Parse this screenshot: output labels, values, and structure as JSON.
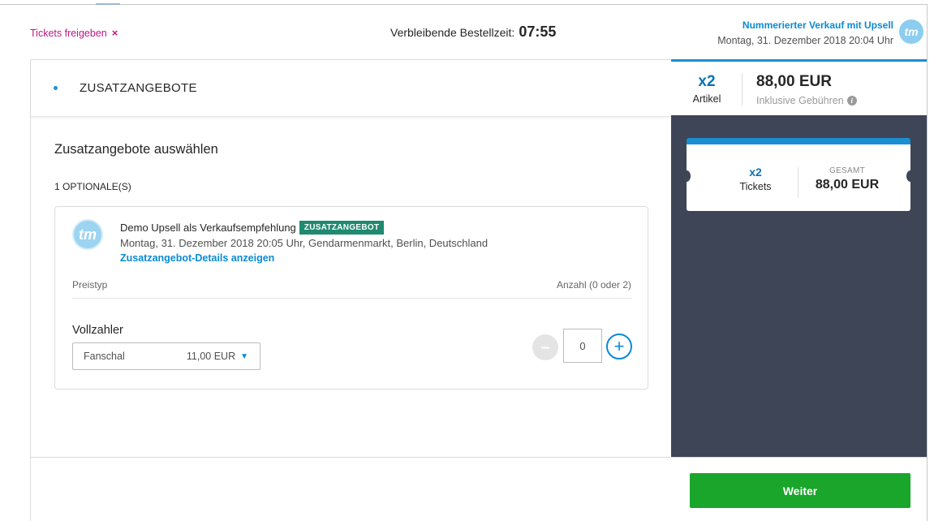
{
  "header": {
    "release_label": "Tickets freigeben",
    "release_icon": "×",
    "timer_label": "Verbleibende Bestellzeit:",
    "timer_value": "07:55",
    "event_name": "Nummerierter Verkauf mit Upsell",
    "event_date": "Montag, 31. Dezember 2018 20:04 Uhr",
    "avatar_text": "tm"
  },
  "section": {
    "title": "ZUSATZANGEBOTE"
  },
  "main": {
    "choose_title": "Zusatzangebote auswählen",
    "optional_count": "1 OPTIONALE(S)",
    "offer": {
      "avatar_text": "tm",
      "name": "Demo Upsell als Verkaufsempfehlung",
      "badge": "ZUSATZANGEBOT",
      "date_location": "Montag, 31. Dezember 2018 20:05 Uhr, Gendarmenmarkt, Berlin, Deutschland",
      "details_link": "Zusatzangebot-Details anzeigen",
      "col_price_type": "Preistyp",
      "col_quantity": "Anzahl (0 oder 2)",
      "price_type": "Vollzahler",
      "select_name": "Fanschal",
      "select_price": "11,00 EUR",
      "quantity": "0"
    }
  },
  "summary": {
    "qty": "x2",
    "qty_label": "Artikel",
    "price": "88,00 EUR",
    "fee_label": "Inklusive Gebühren",
    "ticket_qty": "x2",
    "ticket_label": "Tickets",
    "total_label": "GESAMT",
    "total_price": "88,00 EUR"
  },
  "footer": {
    "continue_label": "Weiter"
  },
  "colors": {
    "accent_blue": "#0a8ad4",
    "release_magenta": "#c0158b",
    "badge_green": "#1f8a70",
    "button_green": "#1aa52b",
    "sidebar_dark": "#3e4557"
  }
}
